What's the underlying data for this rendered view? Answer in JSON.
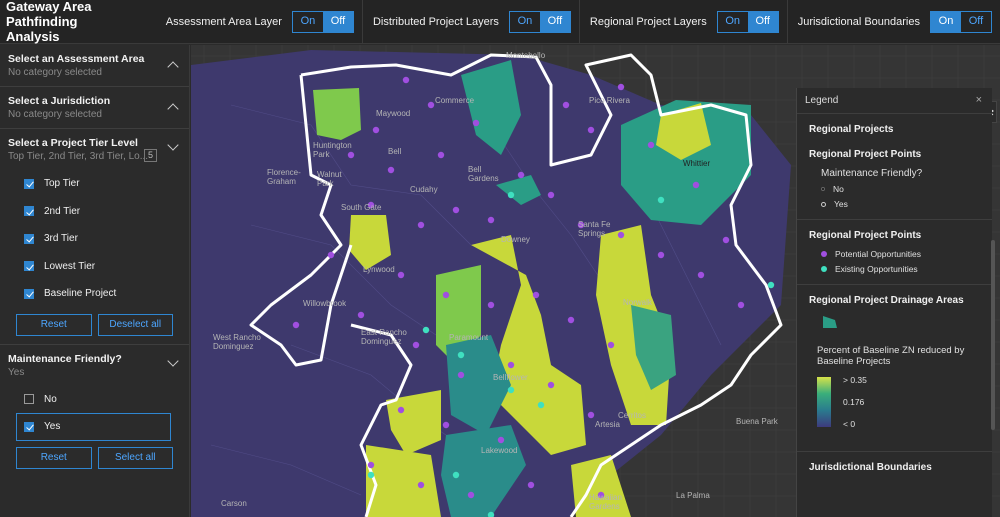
{
  "app": {
    "title_line1": "Gateway Area",
    "title_line2": "Pathfinding Analysis"
  },
  "toggles": [
    {
      "label": "Assessment Area Layer",
      "on": "On",
      "off": "Off",
      "active": "off"
    },
    {
      "label": "Distributed Project Layers",
      "on": "On",
      "off": "Off",
      "active": "off"
    },
    {
      "label": "Regional Project Layers",
      "on": "On",
      "off": "Off",
      "active": "off"
    },
    {
      "label": "Jurisdictional Boundaries",
      "on": "On",
      "off": "Off",
      "active": "on"
    }
  ],
  "sidebar": {
    "assessment": {
      "title": "Select an Assessment Area",
      "sub": "No category selected"
    },
    "jurisdiction": {
      "title": "Select a Jurisdiction",
      "sub": "No category selected"
    },
    "tier": {
      "title": "Select a Project Tier Level",
      "sub": "Top Tier, 2nd Tier, 3rd Tier, Lo...",
      "count": "5",
      "options": [
        "Top Tier",
        "2nd Tier",
        "3rd Tier",
        "Lowest Tier",
        "Baseline Project"
      ],
      "reset": "Reset",
      "deselect": "Deselect all"
    },
    "maintenance": {
      "title": "Maintenance Friendly?",
      "sub": "Yes",
      "options": [
        "No",
        "Yes"
      ],
      "reset": "Reset",
      "select_all": "Select all"
    }
  },
  "legend": {
    "header": "Legend",
    "close": "×",
    "regional_projects": "Regional Projects",
    "points_title": "Regional Project Points",
    "maintenance_q": "Maintenance Friendly?",
    "maint_no": "No",
    "maint_yes": "Yes",
    "points_title2": "Regional Project Points",
    "potential": "Potential Opportunities",
    "existing": "Existing Opportunities",
    "drainage_title": "Regional Project Drainage Areas",
    "ramp_title": "Percent of Baseline ZN reduced by Baseline Projects",
    "ramp_high": "> 0.35",
    "ramp_mid": "0.176",
    "ramp_low": "< 0",
    "jurisdictional": "Jurisdictional Boundaries",
    "colors": {
      "potential": "#a04fe0",
      "existing": "#3fe0c0"
    }
  },
  "map": {
    "places": [
      "Montebello",
      "Commerce",
      "Pico Rivera",
      "Maywood",
      "Huntington Park",
      "Bell",
      "Florence-Graham",
      "Walnut Park",
      "Cudahy",
      "Bell Gardens",
      "Whittier",
      "South Gate",
      "Santa Fe Springs",
      "Downey",
      "Lynwood",
      "Willowbrook",
      "Norwalk",
      "West Rancho Dominguez",
      "East Rancho Dominguez",
      "Paramount",
      "Bellflower",
      "Cerritos",
      "Artesia",
      "Buena Park",
      "Lakewood",
      "Carson",
      "Hawaiian Gardens",
      "La Palma"
    ]
  }
}
